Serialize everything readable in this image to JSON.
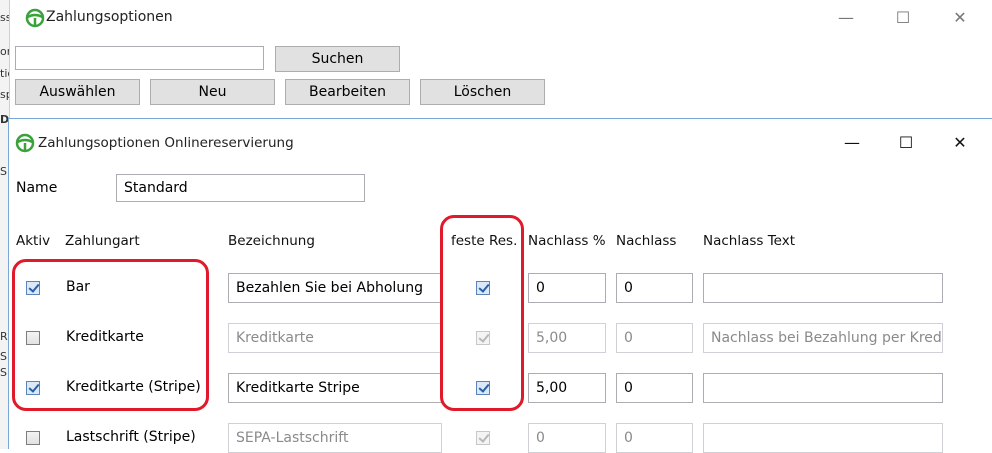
{
  "colors": {
    "highlight": "#e0192b",
    "app_icon": "#3aa23a"
  },
  "background_strip": {
    "fragments": [
      "ss",
      "on",
      "tic",
      "sp",
      "D",
      "S",
      "R",
      "S",
      "S"
    ]
  },
  "outer_window": {
    "title": "Zahlungsoptionen",
    "icon": "steering-wheel-icon",
    "search": {
      "value": "",
      "button": "Suchen"
    },
    "buttons": {
      "select": "Auswählen",
      "new": "Neu",
      "edit": "Bearbeiten",
      "delete": "Löschen"
    },
    "caption": {
      "minimize": "—",
      "maximize": "☐",
      "close": "✕"
    }
  },
  "dialog": {
    "title": "Zahlungsoptionen Onlinereservierung",
    "icon": "steering-wheel-icon",
    "caption": {
      "minimize": "—",
      "maximize": "☐",
      "close": "✕"
    },
    "name_label": "Name",
    "name_value": "Standard",
    "columns": {
      "active": "Aktiv",
      "payment_type": "Zahlungart",
      "description": "Bezeichnung",
      "fixed": "feste Res.",
      "discount_pct": "Nachlass %",
      "discount": "Nachlass",
      "discount_text": "Nachlass Text"
    },
    "rows": [
      {
        "active": true,
        "payment_type": "Bar",
        "description": "Bezahlen Sie bei Abholung",
        "fixed": true,
        "discount_pct": "0",
        "discount": "0",
        "discount_text": "",
        "enabled": true
      },
      {
        "active": false,
        "payment_type": "Kreditkarte",
        "description": "Kreditkarte",
        "fixed": true,
        "discount_pct": "5,00",
        "discount": "0",
        "discount_text": "Nachlass bei Bezahlung per Kreditk",
        "enabled": false
      },
      {
        "active": true,
        "payment_type": "Kreditkarte (Stripe)",
        "description": "Kreditkarte Stripe",
        "fixed": true,
        "discount_pct": "5,00",
        "discount": "0",
        "discount_text": "",
        "enabled": true
      },
      {
        "active": false,
        "payment_type": "Lastschrift (Stripe)",
        "description": "SEPA-Lastschrift",
        "fixed": true,
        "discount_pct": "0",
        "discount": "0",
        "discount_text": "",
        "enabled": false
      }
    ]
  }
}
